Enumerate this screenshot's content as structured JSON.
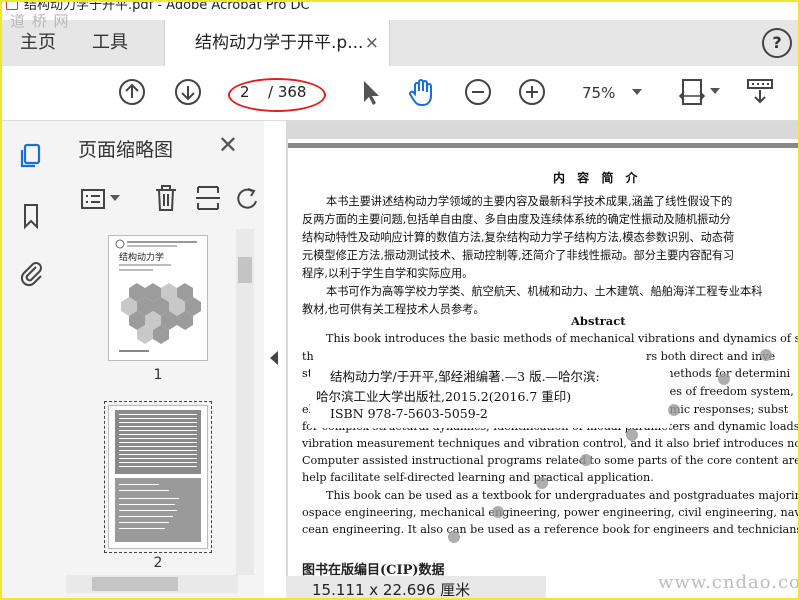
{
  "window": {
    "title_fragment": "结构动力学于开平.pdf - Adobe Acrobat Pro DC"
  },
  "watermarks": {
    "top_left": "道 桥 网",
    "bottom_right": "www.cndao.com"
  },
  "tabs": {
    "home": "主页",
    "tools": "工具",
    "document": "结构动力学于开平.p...",
    "close_symbol": "×",
    "help_symbol": "?"
  },
  "toolbar": {
    "current_page": "2",
    "total_pages": "/ 368",
    "zoom": "75%"
  },
  "panel": {
    "title": "页面缩略图",
    "close_symbol": "✕",
    "thumb1_label": "1",
    "thumb2_label": "2",
    "thumb1_title": "结构动力学"
  },
  "document": {
    "heading": "内 容 简 介",
    "cn_lines": [
      "本书主要讲述结构动力学领域的主要内容及最新科学技术成果,涵盖了线性假设下的",
      "反两方面的主要问题,包括单自由度、多自由度及连续体系统的确定性振动及随机振动分",
      "结构动特性及动响应计算的数值方法,复杂结构动力学子结构方法,模态参数识别、动态荷",
      "元模型修正方法,振动测试技术、振动控制等,还简介了非线性振动。部分主要内容配有习",
      "程序,以利于学生自学和实际应用。",
      "本书可作为高等学校力学类、航空航天、机械和动力、土木建筑、船舶海洋工程专业本科",
      "教材,也可供有关工程技术人员参考。"
    ],
    "abstract_heading": "Abstract",
    "en_lines": [
      "This book introduces the basic methods of mechanical vibrations and dynamics of struc",
      "th",
      "st",
      "el",
      "for complex structural dynamics; identification of modal parameters and dynamic loads; m",
      "vibration measurement techniques and vibration control, and it also brief introduces nonl",
      "Computer assisted instructional programs related to some parts of the core content are prov",
      "help facilitate self-directed learning and practical application.",
      "This book can be used as a textbook for undergraduates and postgraduates majoring in",
      "ospace engineering, mechanical engineering, power engineering, civil engineering, naval arc",
      "cean engineering. It also can be used as a reference book for engineers and technicians."
    ],
    "en_right_fragments": [
      "rs both direct and inve",
      "methods for determini",
      "ees of freedom system,",
      "amic responses; subst"
    ],
    "overlay_lines": [
      "结构动力学/于开平,邹经湘编著.—3 版.—哈尔滨:",
      "哈尔滨工业大学出版社,2015.2(2016.7 重印)",
      "ISBN 978-7-5603-5059-2"
    ],
    "cip_fragment": "图书在版编目(CIP)数据",
    "dimensions": "15.111 x 22.696 厘米"
  }
}
